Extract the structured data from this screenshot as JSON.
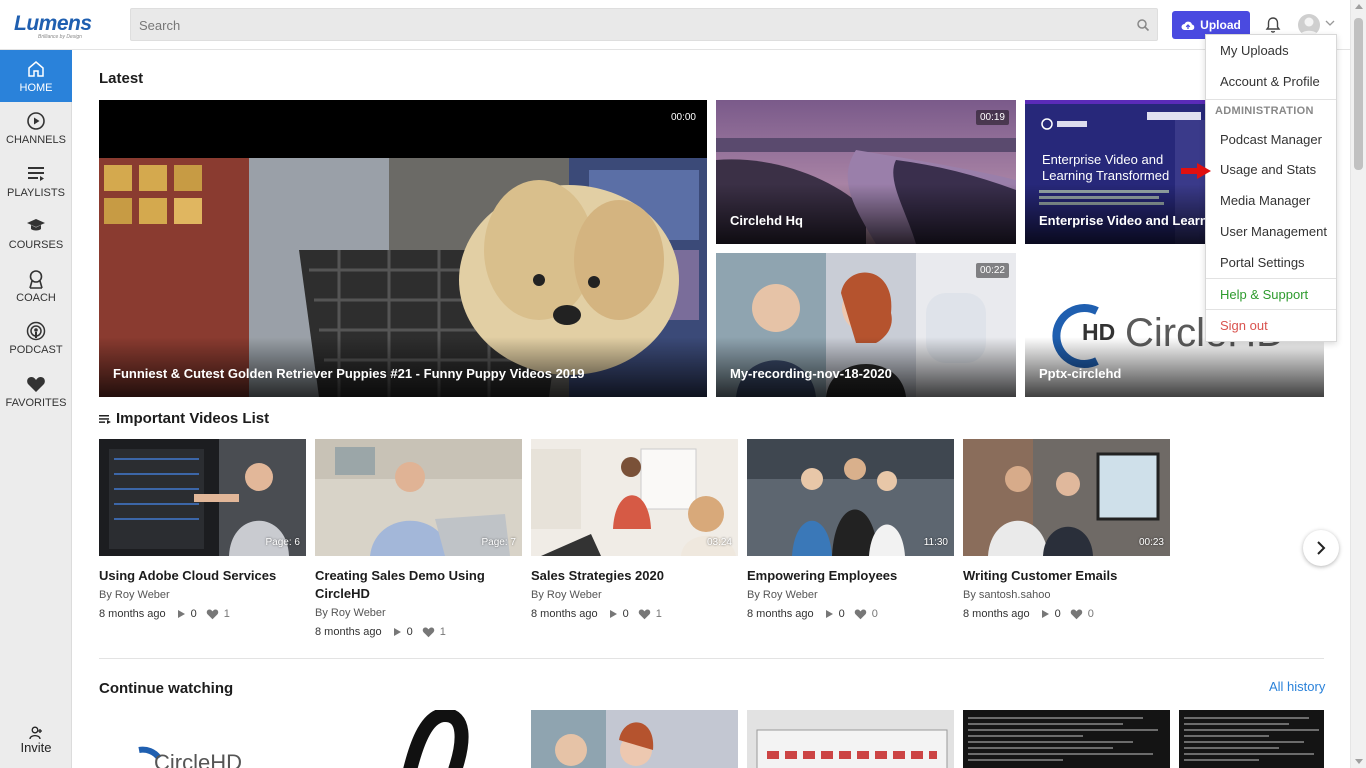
{
  "header": {
    "logo": "Lumens",
    "logo_tagline": "Brilliance by Design",
    "search_placeholder": "Search",
    "upload_label": "Upload"
  },
  "sidebar": {
    "items": [
      {
        "label": "HOME",
        "icon": "home-icon",
        "active": true
      },
      {
        "label": "CHANNELS",
        "icon": "play-circle-icon"
      },
      {
        "label": "PLAYLISTS",
        "icon": "playlist-icon"
      },
      {
        "label": "COURSES",
        "icon": "graduation-cap-icon"
      },
      {
        "label": "COACH",
        "icon": "coach-icon"
      },
      {
        "label": "PODCAST",
        "icon": "podcast-icon"
      },
      {
        "label": "FAVORITES",
        "icon": "heart-icon"
      }
    ],
    "invite_label": "Invite"
  },
  "latest": {
    "heading": "Latest",
    "tiles": [
      {
        "title": "Funniest & Cutest Golden Retriever Puppies #21 - Funny Puppy Videos 2019",
        "duration": "00:00"
      },
      {
        "title": "Circlehd Hq",
        "duration": "00:19"
      },
      {
        "title": "Enterprise Video and Learni",
        "duration": ""
      },
      {
        "title": "My-recording-nov-18-2020",
        "duration": "00:22"
      },
      {
        "title": "Pptx-circlehd",
        "duration": ""
      }
    ],
    "enterprise_overlay_line1": "Enterprise Video and",
    "enterprise_overlay_line2": "Learning Transformed",
    "circlehd_logo_text": "CircleHD",
    "circlehd_logo_hd": "HD"
  },
  "important": {
    "heading": "Important Videos List",
    "cards": [
      {
        "title": "Using Adobe Cloud Services",
        "author": "By Roy Weber",
        "age": "8 months ago",
        "views": "0",
        "likes": "1",
        "badge": "Page: 6"
      },
      {
        "title": "Creating Sales Demo Using CircleHD",
        "author": "By Roy Weber",
        "age": "8 months ago",
        "views": "0",
        "likes": "1",
        "badge": "Page: 7"
      },
      {
        "title": "Sales Strategies 2020",
        "author": "By Roy Weber",
        "age": "8 months ago",
        "views": "0",
        "likes": "1",
        "badge": "03:24"
      },
      {
        "title": "Empowering Employees",
        "author": "By Roy Weber",
        "age": "8 months ago",
        "views": "0",
        "likes": "0",
        "badge": "11:30"
      },
      {
        "title": "Writing Customer Emails",
        "author": "By santosh.sahoo",
        "age": "8 months ago",
        "views": "0",
        "likes": "0",
        "badge": "00:23"
      }
    ]
  },
  "continue": {
    "heading": "Continue watching",
    "all_history": "All history"
  },
  "user_menu": {
    "my_uploads": "My Uploads",
    "account_profile": "Account & Profile",
    "admin_heading": "ADMINISTRATION",
    "podcast_manager": "Podcast Manager",
    "usage_stats": "Usage and Stats",
    "media_manager": "Media Manager",
    "user_management": "User Management",
    "portal_settings": "Portal Settings",
    "help_support": "Help & Support",
    "sign_out": "Sign out"
  },
  "colors": {
    "accent": "#2a82da",
    "upload": "#4a4ae0",
    "help": "#2e9b2e",
    "signout": "#d9534f"
  }
}
